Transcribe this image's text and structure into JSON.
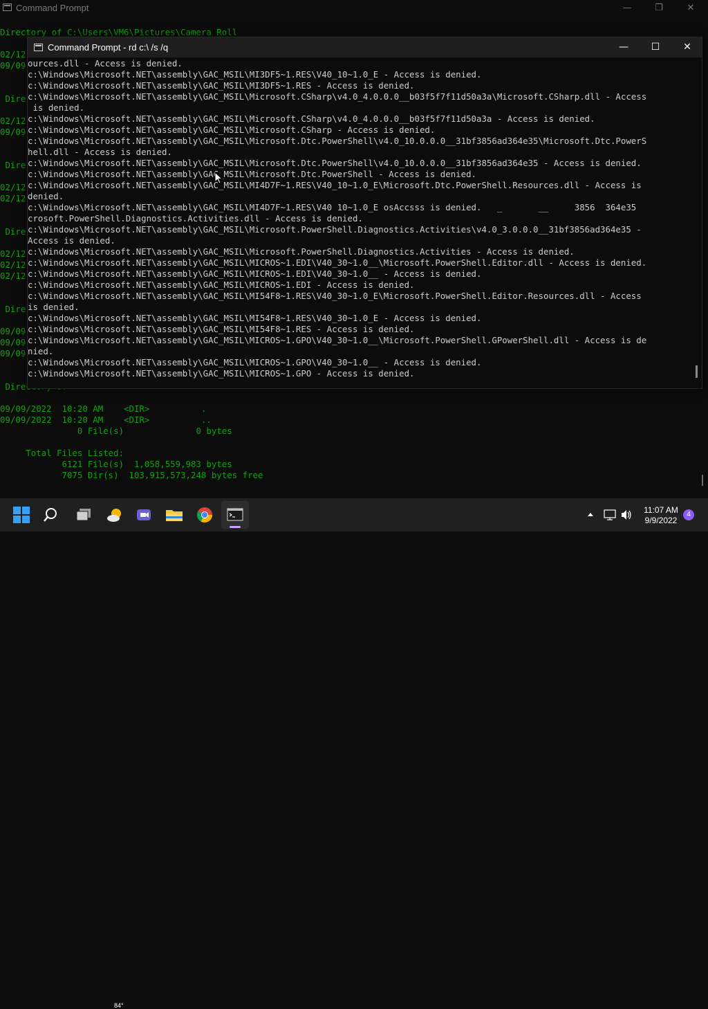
{
  "background_window": {
    "title": "Command Prompt",
    "controls": {
      "minimize": "—",
      "maximize": "❐",
      "close": "✕"
    },
    "lines": [
      "Directory of C:\\Users\\VM6\\Pictures\\Camera Roll",
      "",
      "02/12",
      "09/09",
      "",
      "",
      " Dire",
      "",
      "02/12",
      "09/09",
      "",
      "",
      " Dire",
      "",
      "02/12",
      "02/12",
      "",
      "",
      " Dire",
      "",
      "02/12",
      "02/12",
      "02/12",
      "",
      "",
      " Dire",
      "",
      "09/09",
      "09/09",
      "09/09",
      "",
      "",
      " Directory of ",
      "",
      "09/09/2022  10:20 AM    <DIR>          .",
      "09/09/2022  10:20 AM    <DIR>          ..",
      "               0 File(s)              0 bytes",
      "",
      "     Total Files Listed:",
      "            6121 File(s)  1,058,559,983 bytes",
      "            7075 Dir(s)  103,915,573,248 bytes free"
    ]
  },
  "foreground_window": {
    "title": "Command Prompt - rd  c:\\ /s /q",
    "controls": {
      "minimize": "—",
      "maximize": "☐",
      "close": "✕"
    },
    "lines": [
      "ources.dll - Access is denied.",
      "c:\\Windows\\Microsoft.NET\\assembly\\GAC_MSIL\\MI3DF5~1.RES\\V40_10~1.0_E - Access is denied.",
      "c:\\Windows\\Microsoft.NET\\assembly\\GAC_MSIL\\MI3DF5~1.RES - Access is denied.",
      "c:\\Windows\\Microsoft.NET\\assembly\\GAC_MSIL\\Microsoft.CSharp\\v4.0_4.0.0.0__b03f5f7f11d50a3a\\Microsoft.CSharp.dll - Access",
      " is denied.",
      "c:\\Windows\\Microsoft.NET\\assembly\\GAC_MSIL\\Microsoft.CSharp\\v4.0_4.0.0.0__b03f5f7f11d50a3a - Access is denied.",
      "c:\\Windows\\Microsoft.NET\\assembly\\GAC_MSIL\\Microsoft.CSharp - Access is denied.",
      "c:\\Windows\\Microsoft.NET\\assembly\\GAC_MSIL\\Microsoft.Dtc.PowerShell\\v4.0_10.0.0.0__31bf3856ad364e35\\Microsoft.Dtc.PowerS",
      "hell.dll - Access is denied.",
      "c:\\Windows\\Microsoft.NET\\assembly\\GAC_MSIL\\Microsoft.Dtc.PowerShell\\v4.0_10.0.0.0__31bf3856ad364e35 - Access is denied.",
      "c:\\Windows\\Microsoft.NET\\assembly\\GAC_MSIL\\Microsoft.Dtc.PowerShell - Access is denied.",
      "c:\\Windows\\Microsoft.NET\\assembly\\GAC_MSIL\\MI4D7F~1.RES\\V40_10~1.0_E\\Microsoft.Dtc.PowerShell.Resources.dll - Access is",
      "denied.",
      "c:\\Windows\\Microsoft.NET\\assembly\\GAC_MSIL\\MI4D7F~1.RES\\V40 10~1.0_E osAccsss is denied.   _       __     3856  364e35",
      "crosoft.PowerShell.Diagnostics.Activities.dll - Access is denied.",
      "c:\\Windows\\Microsoft.NET\\assembly\\GAC_MSIL\\Microsoft.PowerShell.Diagnostics.Activities\\v4.0_3.0.0.0__31bf3856ad364e35 -",
      "Access is denied.",
      "c:\\Windows\\Microsoft.NET\\assembly\\GAC_MSIL\\Microsoft.PowerShell.Diagnostics.Activities - Access is denied.",
      "c:\\Windows\\Microsoft.NET\\assembly\\GAC_MSIL\\MICROS~1.EDI\\V40_30~1.0__\\Microsoft.PowerShell.Editor.dll - Access is denied.",
      "c:\\Windows\\Microsoft.NET\\assembly\\GAC_MSIL\\MICROS~1.EDI\\V40_30~1.0__ - Access is denied.",
      "c:\\Windows\\Microsoft.NET\\assembly\\GAC_MSIL\\MICROS~1.EDI - Access is denied.",
      "c:\\Windows\\Microsoft.NET\\assembly\\GAC_MSIL\\MI54F8~1.RES\\V40_30~1.0_E\\Microsoft.PowerShell.Editor.Resources.dll - Access",
      "is denied.",
      "c:\\Windows\\Microsoft.NET\\assembly\\GAC_MSIL\\MI54F8~1.RES\\V40_30~1.0_E - Access is denied.",
      "c:\\Windows\\Microsoft.NET\\assembly\\GAC_MSIL\\MI54F8~1.RES - Access is denied.",
      "c:\\Windows\\Microsoft.NET\\assembly\\GAC_MSIL\\MICROS~1.GPO\\V40_30~1.0__\\Microsoft.PowerShell.GPowerShell.dll - Access is de",
      "nied.",
      "c:\\Windows\\Microsoft.NET\\assembly\\GAC_MSIL\\MICROS~1.GPO\\V40_30~1.0__ - Access is denied.",
      "c:\\Windows\\Microsoft.NET\\assembly\\GAC_MSIL\\MICROS~1.GPO - Access is denied."
    ]
  },
  "taskbar": {
    "apps": [
      {
        "name": "start-button",
        "icon": "windows-logo-icon"
      },
      {
        "name": "search-button",
        "icon": "search-icon"
      },
      {
        "name": "task-view-button",
        "icon": "task-view-icon"
      },
      {
        "name": "weather-widget",
        "icon": "weather-icon",
        "label": "84°"
      },
      {
        "name": "teams-chat-button",
        "icon": "video-chat-icon"
      },
      {
        "name": "file-explorer-button",
        "icon": "folder-icon"
      },
      {
        "name": "chrome-button",
        "icon": "chrome-icon"
      },
      {
        "name": "command-prompt-button",
        "icon": "terminal-icon"
      }
    ],
    "tray": {
      "time": "11:07 AM",
      "date": "9/9/2022",
      "notification_count": "4"
    }
  },
  "colors": {
    "background_console_text": "#13a10e",
    "foreground_console_text": "#cccccc",
    "taskbar": "#202020",
    "active_indicator": "#c9a3ff"
  }
}
